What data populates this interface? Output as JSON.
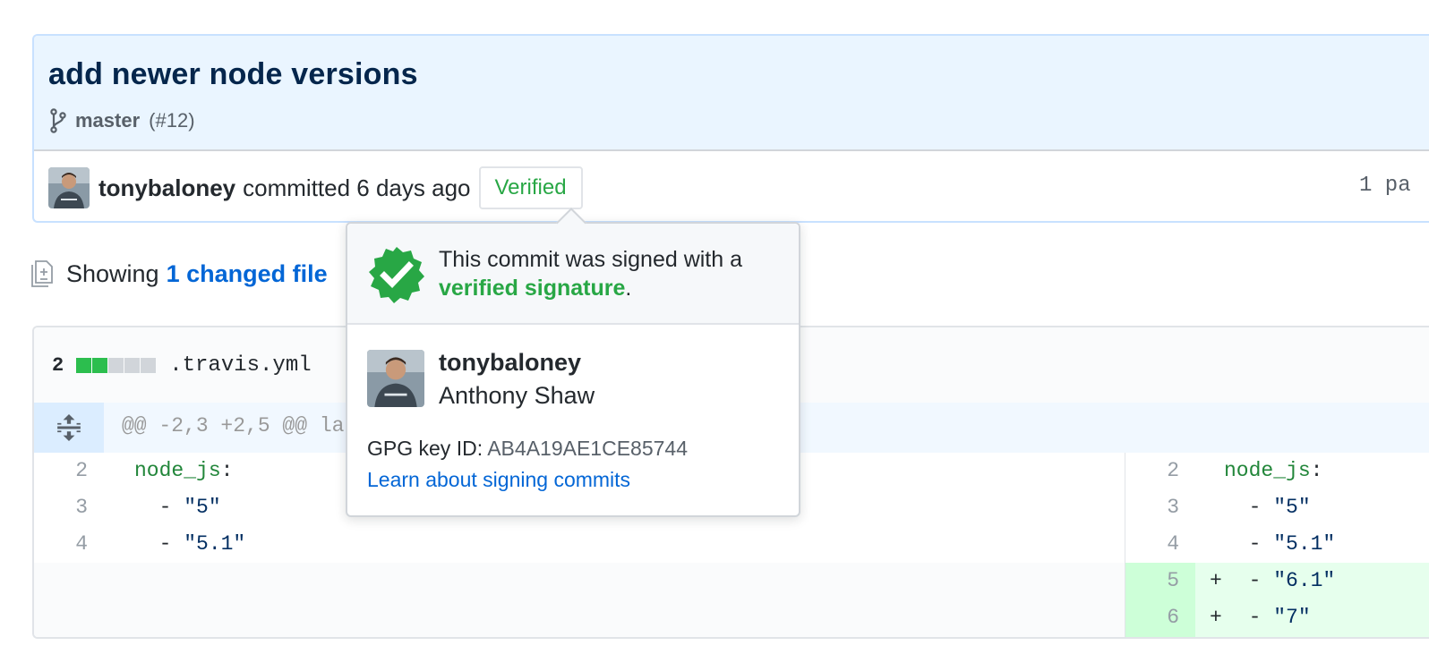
{
  "commit": {
    "title": "add newer node versions",
    "branch": "master",
    "pr_ref": "(#12)",
    "author": "tonybaloney",
    "action_text": "committed 6 days ago",
    "verified_label": "Verified",
    "parent_label": "1 pa"
  },
  "toc": {
    "prefix": "Showing",
    "link": "1 changed file"
  },
  "file": {
    "additions_count": "2",
    "diffstat": [
      "add",
      "add",
      "neutral",
      "neutral",
      "neutral"
    ],
    "name": ".travis.yml",
    "hunk_header": "@@ -2,3 +2,5 @@ la"
  },
  "diff": {
    "left": [
      {
        "ln": "2",
        "key": "node_js",
        "colon": ":",
        "prefix": "",
        "value": ""
      },
      {
        "ln": "3",
        "key": "",
        "colon": "",
        "prefix": "  - ",
        "value": "\"5\""
      },
      {
        "ln": "4",
        "key": "",
        "colon": "",
        "prefix": "  - ",
        "value": "\"5.1\""
      }
    ],
    "right": [
      {
        "ln": "2",
        "marker": "",
        "key": "node_js",
        "colon": ":",
        "prefix": "",
        "value": ""
      },
      {
        "ln": "3",
        "marker": "",
        "key": "",
        "colon": "",
        "prefix": "  - ",
        "value": "\"5\""
      },
      {
        "ln": "4",
        "marker": "",
        "key": "",
        "colon": "",
        "prefix": "  - ",
        "value": "\"5.1\""
      },
      {
        "ln": "5",
        "marker": "+",
        "key": "",
        "colon": "",
        "prefix": "  - ",
        "value": "\"6.1\""
      },
      {
        "ln": "6",
        "marker": "+",
        "key": "",
        "colon": "",
        "prefix": "  - ",
        "value": "\"7\""
      }
    ]
  },
  "popover": {
    "message_prefix": "This commit was signed with a",
    "message_highlight": "verified signature",
    "message_suffix": ".",
    "login": "tonybaloney",
    "full_name": "Anthony Shaw",
    "gpg_label": "GPG key ID:",
    "gpg_key": "AB4A19AE1CE85744",
    "learn_link": "Learn about signing commits"
  },
  "colors": {
    "verified_green": "#28a745",
    "link_blue": "#0366d6",
    "header_blue": "#eaf5ff",
    "addition_bg": "#e6ffed"
  },
  "icons": [
    "git-branch-icon",
    "diff-file-icon",
    "unfold-icon",
    "verified-badge-icon",
    "avatar"
  ]
}
